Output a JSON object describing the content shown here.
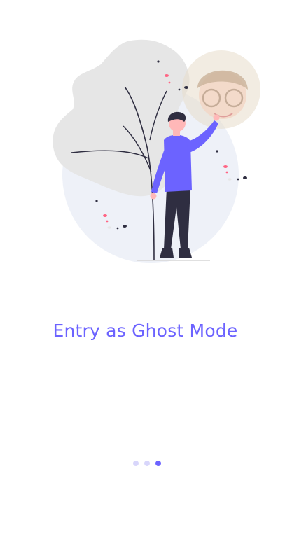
{
  "onboarding": {
    "illustration": "person-reaching-for-avatar-illustration",
    "title": "Entry as Ghost Mode",
    "page_indicator": {
      "total": 3,
      "current": 3
    }
  },
  "colors": {
    "accent": "#6C63FF",
    "dot_inactive": "#D8D6FB",
    "leaf": "#E6E6E6",
    "backdrop_circle": "#EEF1F8",
    "avatar_bg": "#E8DCCB",
    "dark": "#2F2E41",
    "pink": "#FF6584"
  }
}
